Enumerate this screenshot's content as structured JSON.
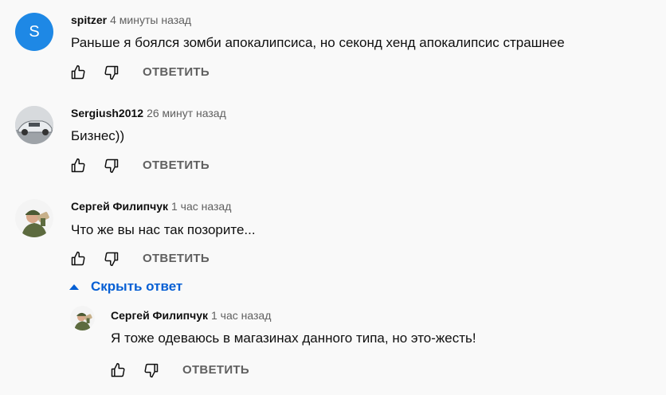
{
  "comments": [
    {
      "author": "spitzer",
      "time": "4 минуты назад",
      "text": "Раньше я боялся зомби апокалипсиса, но секонд хенд апокалипсис страшнее",
      "avatar_letter": "S",
      "reply_label": "ОТВЕТИТЬ"
    },
    {
      "author": "Sergiush2012",
      "time": "26 минут назад",
      "text": "Бизнес))",
      "reply_label": "ОТВЕТИТЬ"
    },
    {
      "author": "Сергей Филипчук",
      "time": "1 час назад",
      "text": "Что же вы нас так позорите...",
      "reply_label": "ОТВЕТИТЬ"
    }
  ],
  "hide_replies_label": "Скрыть ответ",
  "reply": {
    "author": "Сергей Филипчук",
    "time": "1 час назад",
    "text": "Я тоже одеваюсь в магазинах данного типа, но это-жесть!",
    "reply_label": "ОТВЕТИТЬ"
  },
  "colors": {
    "background": "#f9f9f9",
    "link_blue": "#065fd4",
    "secondary_text": "#606060",
    "avatar_blue": "#1e88e5"
  }
}
